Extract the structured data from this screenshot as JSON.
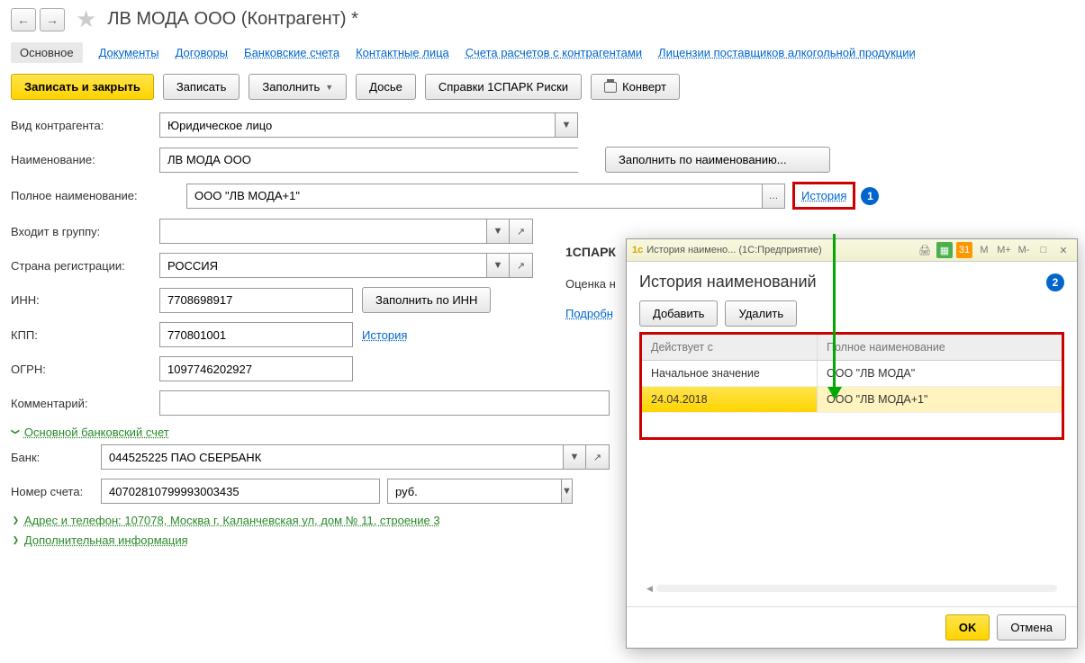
{
  "header": {
    "title": "ЛВ МОДА ООО (Контрагент) *"
  },
  "nav_tabs": {
    "main": "Основное",
    "docs": "Документы",
    "contracts": "Договоры",
    "bank_accounts": "Банковские счета",
    "contacts": "Контактные лица",
    "settlement": "Счета расчетов с контрагентами",
    "licenses": "Лицензии поставщиков алкогольной продукции"
  },
  "toolbar": {
    "save_close": "Записать и закрыть",
    "save": "Записать",
    "fill": "Заполнить",
    "dossier": "Досье",
    "spark": "Справки 1СПАРК Риски",
    "convert": "Конверт"
  },
  "form": {
    "type_label": "Вид контрагента:",
    "type_value": "Юридическое лицо",
    "name_label": "Наименование:",
    "name_value": "ЛВ МОДА ООО",
    "fill_by_name": "Заполнить по наименованию...",
    "fullname_label": "Полное наименование:",
    "fullname_value": "ООО \"ЛВ МОДА+1\"",
    "history_link": "История",
    "group_label": "Входит в группу:",
    "country_label": "Страна регистрации:",
    "country_value": "РОССИЯ",
    "inn_label": "ИНН:",
    "inn_value": "7708698917",
    "fill_by_inn": "Заполнить по ИНН",
    "kpp_label": "КПП:",
    "kpp_value": "770801001",
    "kpp_history": "История",
    "ogrn_label": "ОГРН:",
    "ogrn_value": "1097746202927",
    "comment_label": "Комментарий:",
    "bank_section": "Основной банковский счет",
    "bank_label": "Банк:",
    "bank_value": "044525225 ПАО СБЕРБАНК",
    "account_label": "Номер счета:",
    "account_value": "40702810799993003435",
    "currency": "руб.",
    "address_section": "Адрес и телефон: 107078, Москва г, Каланчевская ул, дом № 11, строение 3",
    "extra_section": "Дополнительная информация"
  },
  "spark": {
    "header": "1СПАРК",
    "rating": "Оценка н",
    "more": "Подробн"
  },
  "callouts": {
    "one": "1",
    "two": "2"
  },
  "popup": {
    "titlebar_text": "История наимено... (1С:Предприятие)",
    "m": "M",
    "m_plus": "M+",
    "m_minus": "M-",
    "title": "История наименований",
    "add": "Добавить",
    "delete": "Удалить",
    "col_date": "Действует с",
    "col_name": "Полное наименование",
    "rows": [
      {
        "date": "Начальное значение",
        "name": "ООО \"ЛВ МОДА\""
      },
      {
        "date": "24.04.2018",
        "name": "ООО \"ЛВ МОДА+1\""
      }
    ],
    "ok": "OK",
    "cancel": "Отмена"
  }
}
